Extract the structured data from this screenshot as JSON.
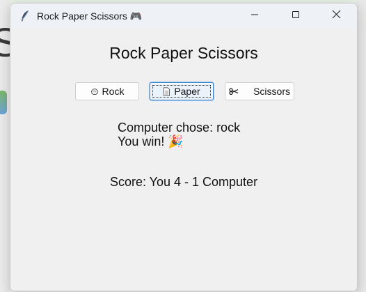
{
  "window": {
    "title": "Rock Paper Scissors 🎮",
    "title_plain": "Rock Paper Scissors",
    "app_icon": "feather-icon",
    "controls": [
      "minimize-icon",
      "maximize-icon",
      "close-icon"
    ]
  },
  "app": {
    "heading": "Rock Paper Scissors",
    "buttons": {
      "rock": {
        "label": "Rock",
        "icon": "rock-icon"
      },
      "paper": {
        "label": "Paper",
        "icon": "paper-icon"
      },
      "scissors": {
        "label": "Scissors",
        "icon": "scissors-icon"
      }
    },
    "result": {
      "computer_choice": "Computer chose: rock",
      "outcome": "You win! 🎉"
    },
    "score": "Score: You 4 - 1 Computer"
  },
  "background": {
    "partial_letter": "S"
  },
  "colors": {
    "focus_border": "#3a82c8",
    "window_bg": "#f0f0f0",
    "titlebar_bg": "#eef1f6"
  }
}
